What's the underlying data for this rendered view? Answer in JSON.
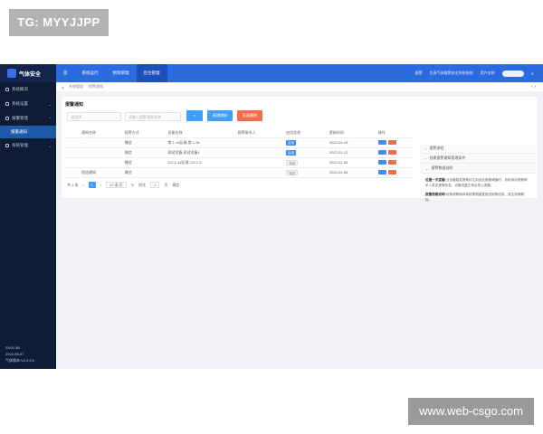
{
  "watermarks": {
    "top": "TG: MYYJJPP",
    "bottom": "www.web-csgo.com"
  },
  "app": {
    "title": "气体安全"
  },
  "sidebar": {
    "items": [
      {
        "label": "系统概况"
      },
      {
        "label": "系统设置"
      },
      {
        "label": "报警管理"
      },
      {
        "label": "系统管理"
      }
    ],
    "sub_item": "报警通知",
    "footer": {
      "time": "23:01:36",
      "date": "2022-05-07",
      "version": "气体版本:V2.0.0.0"
    }
  },
  "topbar": {
    "tabs": [
      {
        "label": "首"
      },
      {
        "label": "系统运行"
      },
      {
        "label": "物资管理"
      },
      {
        "label": "后台管理"
      }
    ],
    "right": {
      "alarm": "报警",
      "dept": "负责气体报警安全系统系统",
      "user": "用户名称"
    }
  },
  "breadcrumb": {
    "home": "系统管理",
    "current": "报警通知",
    "arrows": "‹ ›"
  },
  "panel": {
    "title": "报警通知",
    "filter_select": "请选择",
    "filter_input_placeholder": "请输入报警通知名称",
    "buttons": {
      "add": "新增通知",
      "batch": "批量删除"
    }
  },
  "table": {
    "headers": [
      "通知名称",
      "报警方式",
      "设备名称",
      "报警联系人",
      "启用状态",
      "更新时间",
      "操作"
    ],
    "rows": [
      {
        "name": "-",
        "method": "微信",
        "device": "常 1-1#区域,常 1-2#",
        "contact": "",
        "status": "启用",
        "status_on": true,
        "time": "2022-01-19"
      },
      {
        "name": "",
        "method": "微信",
        "device": "测试设备,测试设备1",
        "contact": "",
        "status": "启用",
        "status_on": true,
        "time": "2022-01-12"
      },
      {
        "name": "",
        "method": "微信",
        "device": "CO 1-1#区域,CO 1-2",
        "contact": "",
        "status": "关闭",
        "status_on": false,
        "time": "2022-01-06"
      },
      {
        "name": "短信通知",
        "method": "微信",
        "device": "",
        "contact": "",
        "status": "关闭",
        "status_on": false,
        "time": "2022-01-06"
      }
    ]
  },
  "pager": {
    "total": "共 4 条",
    "page": "1",
    "size": "20 条/页",
    "goto": "前往",
    "unit": "页",
    "confirm": "确定"
  },
  "help": {
    "items": [
      {
        "label": "报警流程"
      },
      {
        "label": "创建报警通知管理条件"
      },
      {
        "label": "报警数据说明"
      }
    ],
    "texts": [
      {
        "head": "设置一次提醒:",
        "body": "当设备触发报警并达到设定报警阈值时，系统将向报警联系人发送报警信息，设备恢复正常后停止提醒。"
      },
      {
        "head": "报警周期说明:",
        "body": "设备报警期间将按周期重复推送报警信息，直至报警解除。"
      }
    ]
  }
}
